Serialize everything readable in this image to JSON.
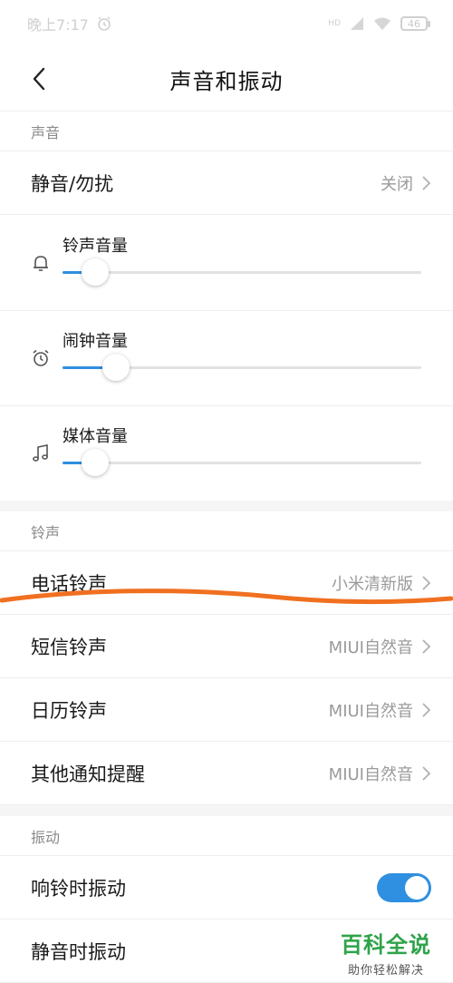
{
  "status_bar": {
    "time": "晚上7:17",
    "battery": "46",
    "signal": "HD"
  },
  "header": {
    "title": "声音和振动"
  },
  "sections": {
    "sound": {
      "title": "声音",
      "dnd": {
        "label": "静音/勿扰",
        "value": "关闭"
      },
      "sliders": [
        {
          "label": "铃声音量",
          "icon": "bell-icon",
          "level": 0.09
        },
        {
          "label": "闹钟音量",
          "icon": "alarm-clock-icon",
          "level": 0.15
        },
        {
          "label": "媒体音量",
          "icon": "music-note-icon",
          "level": 0.09
        }
      ]
    },
    "ringtone": {
      "title": "铃声",
      "items": [
        {
          "label": "电话铃声",
          "value": "小米清新版"
        },
        {
          "label": "短信铃声",
          "value": "MIUI自然音"
        },
        {
          "label": "日历铃声",
          "value": "MIUI自然音"
        },
        {
          "label": "其他通知提醒",
          "value": "MIUI自然音"
        }
      ]
    },
    "vibration": {
      "title": "振动",
      "items": [
        {
          "label": "响铃时振动",
          "toggle": true
        },
        {
          "label": "静音时振动"
        }
      ]
    }
  },
  "watermark": {
    "title": "百科全说",
    "subtitle": "助你轻松解决"
  },
  "colors": {
    "accent": "#2f8fe0",
    "annotation": "#f07020",
    "watermark": "#2ea34a"
  }
}
